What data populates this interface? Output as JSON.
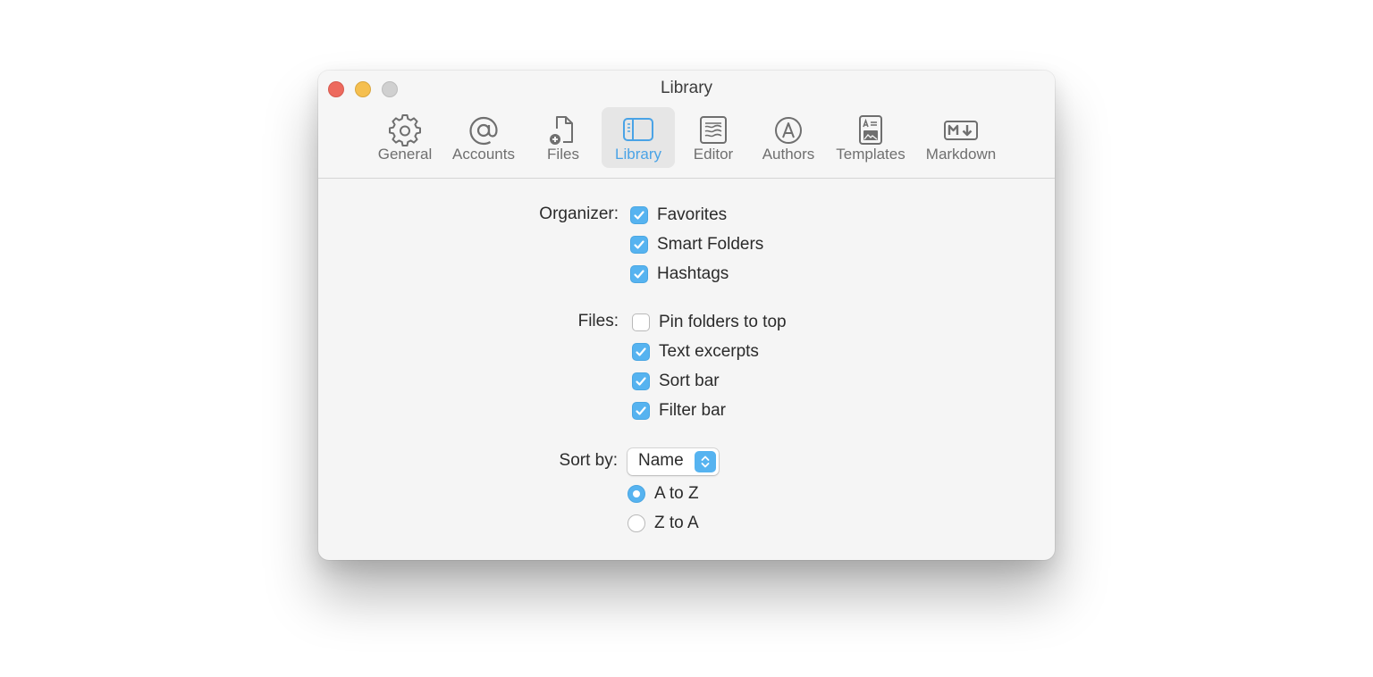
{
  "window": {
    "title": "Library"
  },
  "toolbar": {
    "tabs": [
      {
        "label": "General",
        "icon": "gear-icon"
      },
      {
        "label": "Accounts",
        "icon": "at-icon"
      },
      {
        "label": "Files",
        "icon": "file-add-icon"
      },
      {
        "label": "Library",
        "icon": "sidebar-icon",
        "active": true
      },
      {
        "label": "Editor",
        "icon": "editor-icon"
      },
      {
        "label": "Authors",
        "icon": "author-icon"
      },
      {
        "label": "Templates",
        "icon": "template-icon"
      },
      {
        "label": "Markdown",
        "icon": "markdown-icon"
      }
    ]
  },
  "organizer": {
    "label": "Organizer:",
    "options": [
      {
        "label": "Favorites",
        "checked": true
      },
      {
        "label": "Smart Folders",
        "checked": true
      },
      {
        "label": "Hashtags",
        "checked": true
      }
    ]
  },
  "files": {
    "label": "Files:",
    "options": [
      {
        "label": "Pin folders to top",
        "checked": false
      },
      {
        "label": "Text excerpts",
        "checked": true
      },
      {
        "label": "Sort bar",
        "checked": true
      },
      {
        "label": "Filter bar",
        "checked": true
      }
    ]
  },
  "sort": {
    "label": "Sort by:",
    "selected": "Name",
    "orders": [
      {
        "label": "A to Z",
        "selected": true
      },
      {
        "label": "Z to A",
        "selected": false
      }
    ]
  },
  "colors": {
    "accent": "#56b3f0",
    "close": "#ed6a5e",
    "minimize": "#f5bf4f",
    "zoom": "#d0d0d0"
  }
}
